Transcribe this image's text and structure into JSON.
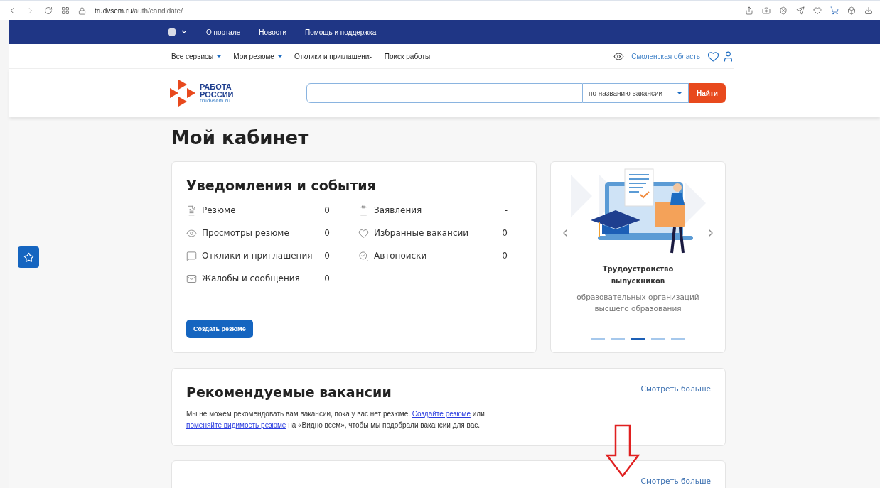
{
  "browser": {
    "url_host": "trudvsem.ru",
    "url_path": "/auth/candidate/"
  },
  "top_bar": {
    "links": [
      "О портале",
      "Новости",
      "Помощь и поддержка"
    ]
  },
  "nav": {
    "items": [
      {
        "label": "Все сервисы",
        "dropdown": true
      },
      {
        "label": "Мои резюме",
        "dropdown": true
      },
      {
        "label": "Отклики и приглашения",
        "dropdown": false
      },
      {
        "label": "Поиск работы",
        "dropdown": false
      }
    ],
    "region": "Смоленская область"
  },
  "logo": {
    "line1": "РАБОТА",
    "line2": "РОССИИ",
    "domain": "trudvsem.ru"
  },
  "search": {
    "search_type": "по названию вакансии",
    "button": "Найти"
  },
  "page_title": "Мой кабинет",
  "notifications": {
    "title": "Уведомления и события",
    "columns": [
      [
        {
          "kind": "document",
          "label": "Резюме",
          "count": "0"
        },
        {
          "kind": "eye",
          "label": "Просмотры резюме",
          "count": "0"
        },
        {
          "kind": "chat",
          "label": "Отклики и приглашения",
          "count": "0"
        },
        {
          "kind": "mail",
          "label": "Жалобы и сообщения",
          "count": "0"
        }
      ],
      [
        {
          "kind": "clipboard",
          "label": "Заявления",
          "count": "-"
        },
        {
          "kind": "heart",
          "label": "Избранные вакансии",
          "count": "0"
        },
        {
          "kind": "autosearch",
          "label": "Автопоиски",
          "count": "0"
        }
      ]
    ],
    "button": "Создать резюме"
  },
  "carousel": {
    "title": "Трудоустройство выпускников",
    "subtitle": "образовательных организаций высшего образования",
    "slides": [
      {
        "selected": false
      },
      {
        "selected": false
      },
      {
        "selected": true
      },
      {
        "selected": false
      },
      {
        "selected": false
      }
    ]
  },
  "recommended": {
    "title": "Рекомендуемые вакансии",
    "more": "Смотреть больше",
    "text": [
      {
        "kind": "text",
        "value": "Мы не можем рекомендовать вам вакансии, пока у вас нет резюме. "
      },
      {
        "kind": "link",
        "value": "Создайте резюме"
      },
      {
        "kind": "text",
        "value": " или "
      },
      {
        "kind": "break"
      },
      {
        "kind": "link",
        "value": "поменяйте видимость резюме"
      },
      {
        "kind": "text",
        "value": " на «Видно всем», чтобы мы подобрали вакансии для вас."
      }
    ]
  },
  "next_card": {
    "more": "Смотреть больше"
  }
}
